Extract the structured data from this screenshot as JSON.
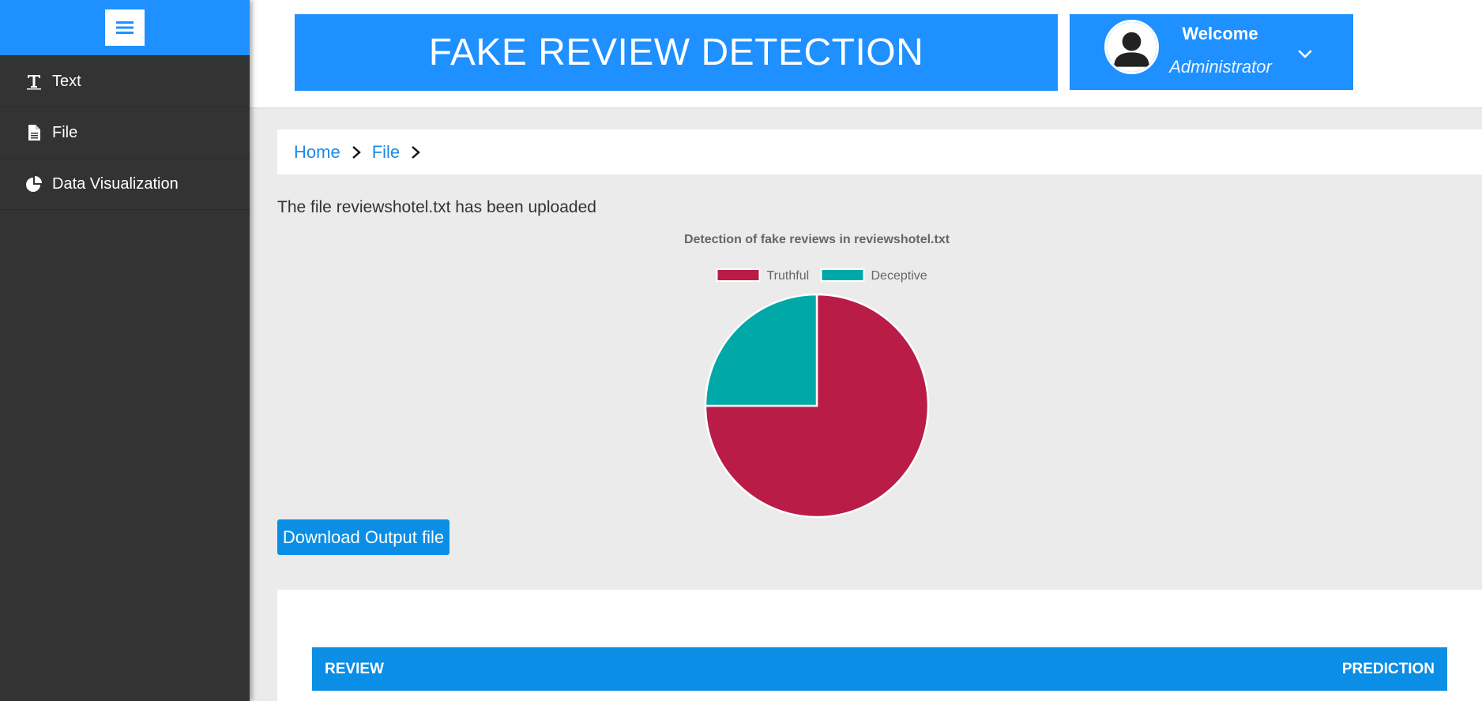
{
  "sidebar": {
    "menu_icon": "hamburger-menu-icon",
    "items": [
      {
        "label": "Text",
        "icon": "text-format-icon"
      },
      {
        "label": "File",
        "icon": "file-document-icon"
      },
      {
        "label": "Data Visualization",
        "icon": "pie-chart-icon"
      }
    ]
  },
  "header": {
    "title": "FAKE REVIEW DETECTION",
    "user": {
      "greeting": "Welcome",
      "role": "Administrator",
      "avatar_icon": "user-avatar-icon",
      "dropdown_icon": "chevron-down-icon"
    }
  },
  "breadcrumb": {
    "items": [
      "Home",
      "File"
    ]
  },
  "main": {
    "upload_message": "The file reviewshotel.txt has been uploaded",
    "download_label": "Download Output file"
  },
  "table": {
    "columns": [
      "REVIEW",
      "PREDICTION"
    ]
  },
  "colors": {
    "primary": "#1e90ff",
    "sidebar": "#333333",
    "truthful": "#b91c47",
    "deceptive": "#00a8a8"
  },
  "chart_data": {
    "type": "pie",
    "title": "Detection of fake reviews in reviewshotel.txt",
    "labels": [
      "Truthful",
      "Deceptive"
    ],
    "values": [
      75,
      25
    ],
    "colors": [
      "#b91c47",
      "#00a8a8"
    ],
    "legend": "top"
  }
}
